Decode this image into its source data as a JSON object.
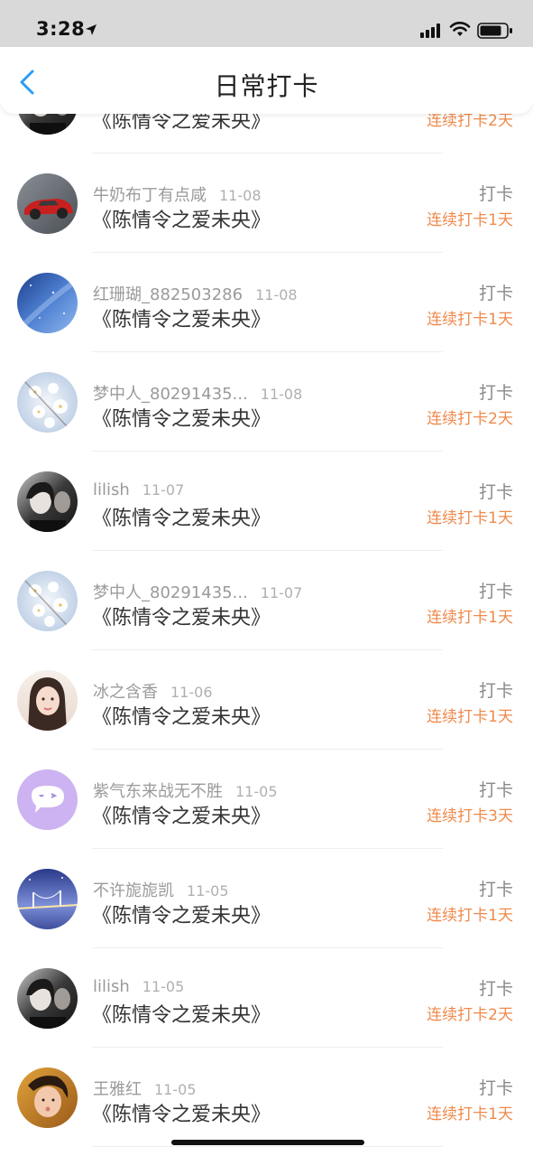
{
  "status_bar": {
    "time": "3:28",
    "icons": [
      "location-arrow-icon",
      "signal-icon",
      "wifi-icon",
      "battery-icon"
    ]
  },
  "nav": {
    "title": "日常打卡",
    "back_icon": "chevron-left-icon",
    "accent_color": "#2a9df4"
  },
  "colors": {
    "streak": "#ef8a4c",
    "name": "#9a9a9a",
    "title": "#333333"
  },
  "items": [
    {
      "name": "",
      "date": "",
      "title": "《陈情令之爱未央》",
      "action": "",
      "streak": "连续打卡2天",
      "avatar": "dark-portrait-avatar"
    },
    {
      "name": "牛奶布丁有点咸",
      "date": "11-08",
      "title": "《陈情令之爱未央》",
      "action": "打卡",
      "streak": "连续打卡1天",
      "avatar": "red-car-avatar"
    },
    {
      "name": "红珊瑚_882503286",
      "date": "11-08",
      "title": "《陈情令之爱未央》",
      "action": "打卡",
      "streak": "连续打卡1天",
      "avatar": "starry-sky-avatar"
    },
    {
      "name": "梦中人_80291435...",
      "date": "11-08",
      "title": "《陈情令之爱未央》",
      "action": "打卡",
      "streak": "连续打卡2天",
      "avatar": "white-flowers-avatar"
    },
    {
      "name": "lilish",
      "date": "11-07",
      "title": "《陈情令之爱未央》",
      "action": "打卡",
      "streak": "连续打卡1天",
      "avatar": "dark-portrait-avatar"
    },
    {
      "name": "梦中人_80291435...",
      "date": "11-07",
      "title": "《陈情令之爱未央》",
      "action": "打卡",
      "streak": "连续打卡1天",
      "avatar": "white-flowers-avatar"
    },
    {
      "name": "冰之含香",
      "date": "11-06",
      "title": "《陈情令之爱未央》",
      "action": "打卡",
      "streak": "连续打卡1天",
      "avatar": "girl-portrait-avatar"
    },
    {
      "name": "紫气东来战无不胜",
      "date": "11-05",
      "title": "《陈情令之爱未央》",
      "action": "打卡",
      "streak": "连续打卡3天",
      "avatar": "purple-chat-avatar"
    },
    {
      "name": "不许旎旎凯",
      "date": "11-05",
      "title": "《陈情令之爱未央》",
      "action": "打卡",
      "streak": "连续打卡1天",
      "avatar": "night-bridge-avatar"
    },
    {
      "name": "lilish",
      "date": "11-05",
      "title": "《陈情令之爱未央》",
      "action": "打卡",
      "streak": "连续打卡2天",
      "avatar": "dark-portrait-avatar"
    },
    {
      "name": "王雅红",
      "date": "11-05",
      "title": "《陈情令之爱未央》",
      "action": "打卡",
      "streak": "连续打卡1天",
      "avatar": "child-photo-avatar"
    }
  ]
}
